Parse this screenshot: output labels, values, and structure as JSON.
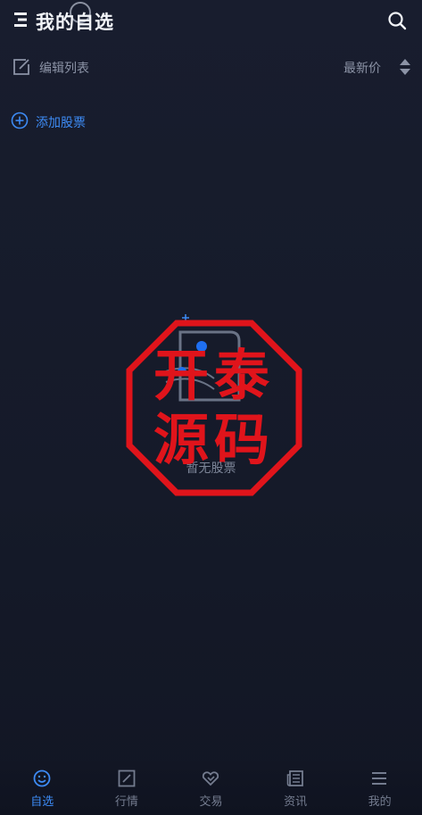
{
  "header": {
    "title": "我的自选",
    "menu_icon": "menu-icon",
    "search_icon": "search-icon"
  },
  "toolbar": {
    "edit_label": "编辑列表",
    "sort_label": "最新价",
    "edit_icon": "edit-icon",
    "sort_icon": "sort-updown-icon"
  },
  "add_stock": {
    "label": "添加股票",
    "icon": "plus-circle-icon"
  },
  "empty_state": {
    "label": "暂无股票",
    "icon": "empty-document-icon"
  },
  "watermark": {
    "line1": "开泰",
    "line2": "源码",
    "color": "#e0141b"
  },
  "tabbar": {
    "tabs": [
      {
        "label": "自选",
        "icon": "smile-icon",
        "active": true
      },
      {
        "label": "行情",
        "icon": "chart-box-icon",
        "active": false
      },
      {
        "label": "交易",
        "icon": "handshake-icon",
        "active": false
      },
      {
        "label": "资讯",
        "icon": "news-icon",
        "active": false
      },
      {
        "label": "我的",
        "icon": "menu-lines-icon",
        "active": false
      }
    ]
  },
  "colors": {
    "background": "#161b2b",
    "accent": "#3d8bf5",
    "muted_text": "#8c93a6"
  }
}
